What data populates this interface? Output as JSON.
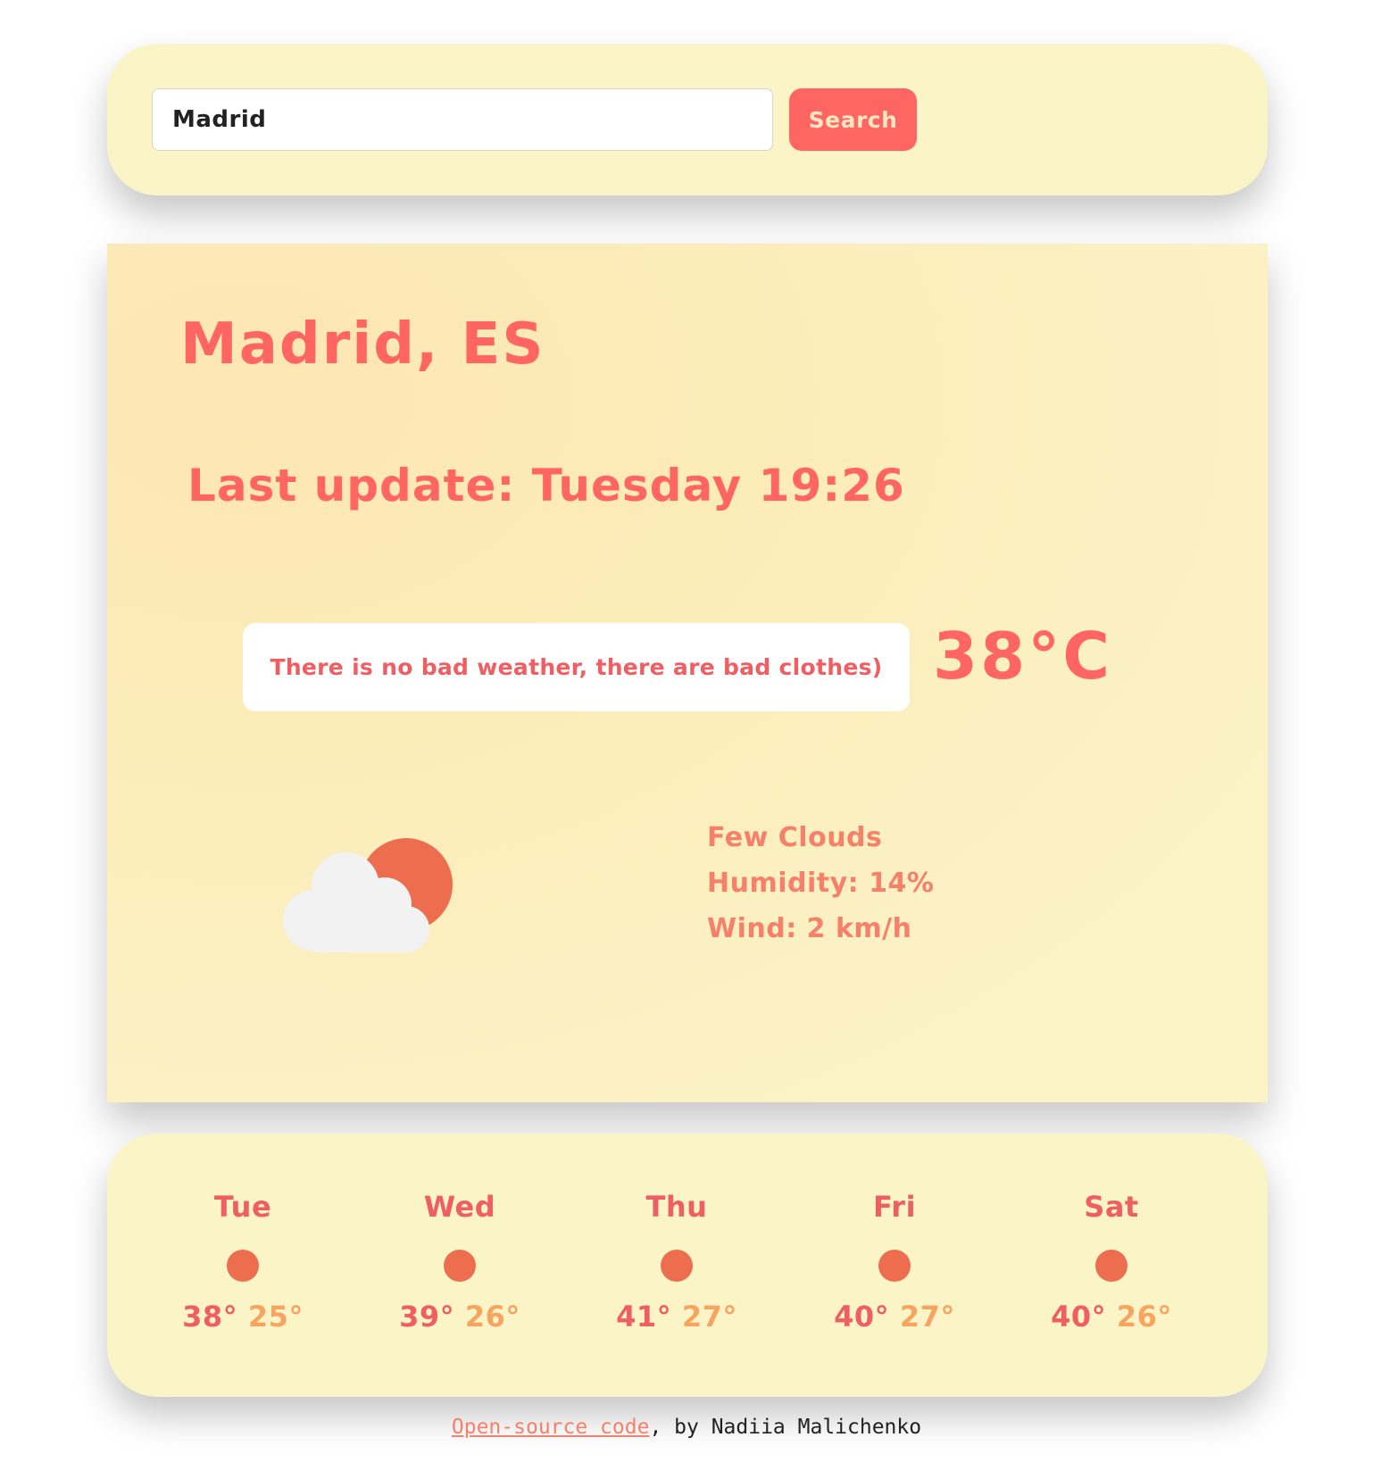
{
  "search": {
    "input_value": "Madrid",
    "button_label": "Search"
  },
  "current": {
    "city": "Madrid, ES",
    "last_update": "Last update: Tuesday 19:26",
    "quote": "There is no bad weather, there are bad clothes)",
    "temperature": "38°C",
    "icon": "few-clouds-icon",
    "description": "Few Clouds",
    "humidity": "Humidity: 14%",
    "wind": "Wind: 2 km/h"
  },
  "forecast": [
    {
      "day": "Tue",
      "max": "38°",
      "min": "25°",
      "icon": "sun-icon"
    },
    {
      "day": "Wed",
      "max": "39°",
      "min": "26°",
      "icon": "sun-icon"
    },
    {
      "day": "Thu",
      "max": "41°",
      "min": "27°",
      "icon": "sun-icon"
    },
    {
      "day": "Fri",
      "max": "40°",
      "min": "27°",
      "icon": "sun-icon"
    },
    {
      "day": "Sat",
      "max": "40°",
      "min": "26°",
      "icon": "sun-icon"
    }
  ],
  "footer": {
    "link_text": "Open-source code",
    "suffix": ", by Nadiia Malichenko"
  },
  "colors": {
    "accent": "#ff6563",
    "card_bg": "#fbf4c7",
    "sun": "#ed6e4e",
    "min_temp": "#f8a461"
  }
}
